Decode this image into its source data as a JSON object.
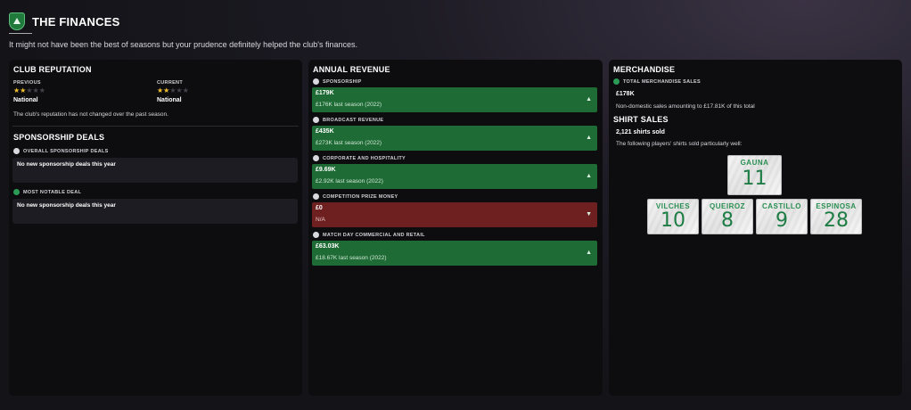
{
  "header": {
    "title": "THE FINANCES",
    "subtitle": "It might not have been the best of seasons but your prudence definitely helped the club's finances."
  },
  "reputation": {
    "heading": "CLUB REPUTATION",
    "previous_label": "PREVIOUS",
    "previous_stars": 2,
    "previous_value": "National",
    "current_label": "CURRENT",
    "current_stars": 2,
    "current_value": "National",
    "note": "The club's reputation has not changed over the past season."
  },
  "sponsorship": {
    "heading": "SPONSORSHIP DEALS",
    "overall_label": "OVERALL SPONSORSHIP DEALS",
    "overall_value": "No new sponsorship deals this year",
    "notable_label": "MOST NOTABLE DEAL",
    "notable_value": "No new sponsorship deals this year"
  },
  "revenue": {
    "heading": "ANNUAL REVENUE",
    "items": [
      {
        "label": "SPONSORSHIP",
        "amount": "£179K",
        "last": "£176K last season (2022)",
        "trend": "up",
        "status": "positive"
      },
      {
        "label": "BROADCAST REVENUE",
        "amount": "£435K",
        "last": "£273K last season (2022)",
        "trend": "up",
        "status": "positive"
      },
      {
        "label": "CORPORATE AND HOSPITALITY",
        "amount": "£9.69K",
        "last": "£2.92K last season (2022)",
        "trend": "up",
        "status": "positive"
      },
      {
        "label": "COMPETITION PRIZE MONEY",
        "amount": "£0",
        "last": "N/A",
        "trend": "down",
        "status": "negative"
      },
      {
        "label": "MATCH DAY COMMERCIAL AND RETAIL",
        "amount": "£63.03K",
        "last": "£18.67K last season (2022)",
        "trend": "up",
        "status": "positive"
      }
    ]
  },
  "merchandise": {
    "heading": "MERCHANDISE",
    "total_label": "TOTAL MERCHANDISE SALES",
    "total_value": "£178K",
    "total_note": "Non-domestic sales amounting to £17.81K of this total",
    "shirt_heading": "SHIRT SALES",
    "shirts_sold": "2,121 shirts sold",
    "shirts_note": "The following players' shirts sold particularly well:",
    "players": [
      {
        "name": "GAUNA",
        "number": "11"
      },
      {
        "name": "VILCHES",
        "number": "10"
      },
      {
        "name": "QUEIROZ",
        "number": "8"
      },
      {
        "name": "CASTILLO",
        "number": "9"
      },
      {
        "name": "ESPINOSA",
        "number": "28"
      }
    ]
  },
  "colors": {
    "positive": "#1f6b35",
    "negative": "#6e1f1f",
    "star": "#f2c230",
    "shirt_text": "#2a8f52"
  }
}
